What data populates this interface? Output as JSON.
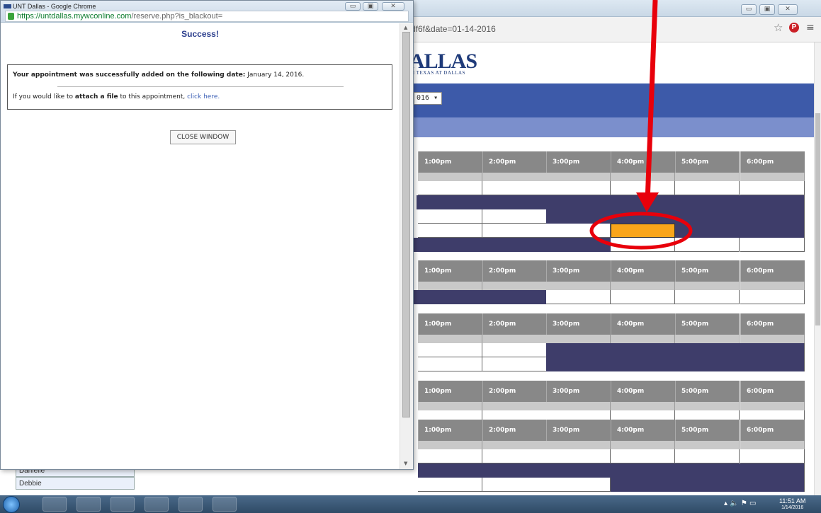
{
  "popup": {
    "window_title": "UNT Dallas - Google Chrome",
    "url_main": "https://untdallas.mywconline.com",
    "url_rest": "/reserve.php?is_blackout=",
    "success_title": "Success!",
    "msg_bold": "Your appointment was successfully added on the following date:",
    "msg_date": "January 14, 2016.",
    "attach_pre": "If you would like to ",
    "attach_bold": "attach a file",
    "attach_mid": " to this appointment, ",
    "attach_link": "click here.",
    "close_button": "CLOSE WINDOW",
    "window_controls": {
      "minimize": "▭",
      "maximize": "▣",
      "close": "✕"
    }
  },
  "background": {
    "url_fragment": "df6f&date=01-14-2016",
    "logo": "ALLAS",
    "logo_sub": "H TEXAS AT DALLAS",
    "date_select": "016",
    "time_headers": [
      "1:00pm",
      "2:00pm",
      "3:00pm",
      "4:00pm",
      "5:00pm",
      "6:00pm"
    ],
    "staff": [
      "Danielle",
      "Debbie"
    ]
  },
  "taskbar": {
    "time": "11:51 AM",
    "date": "1/14/2016"
  },
  "colors": {
    "navy_block": "#3e3d6a",
    "highlight": "#f9a51a",
    "annotation": "#e8000b",
    "banner": "#3d5aa9"
  }
}
